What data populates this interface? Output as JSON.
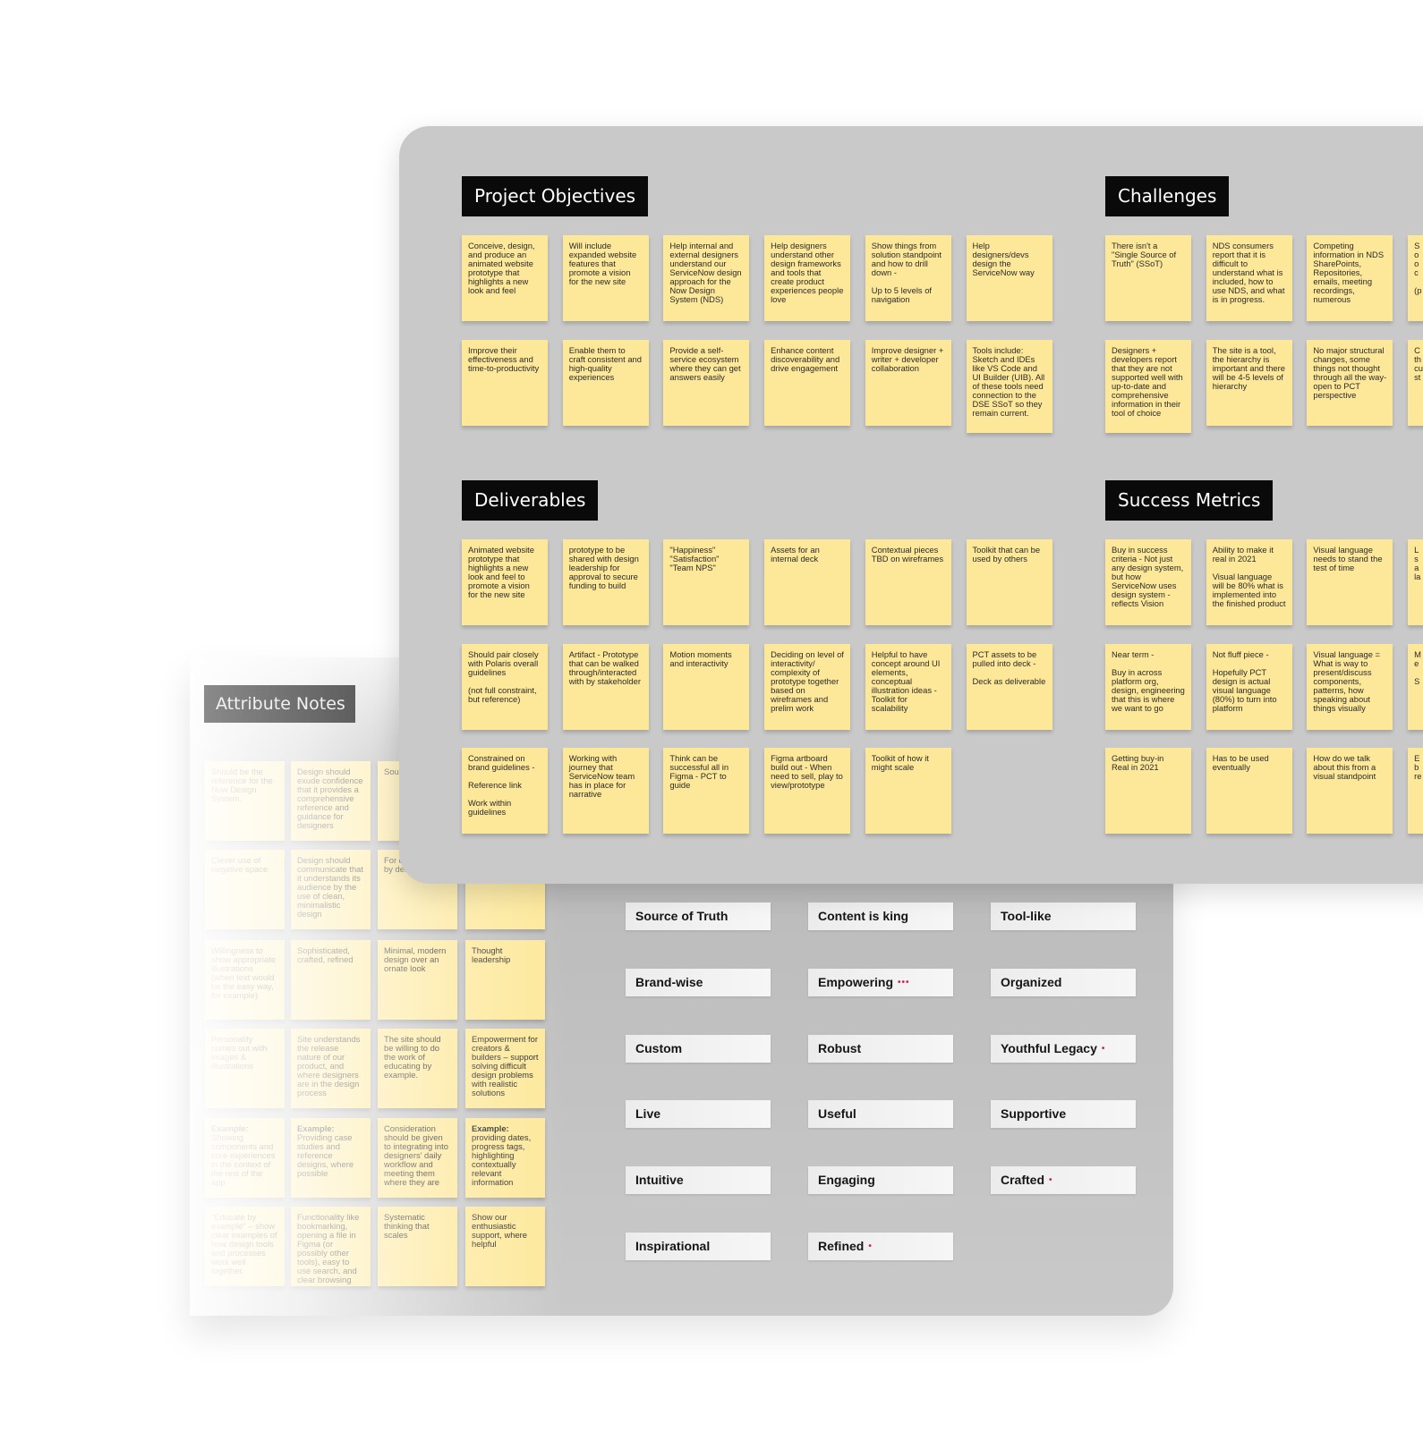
{
  "attribute_notes": {
    "title": "Attribute Notes",
    "columns": [
      [
        "Should be the reference for the Now Design System.",
        "Clever use of negative space",
        "Willingness to show appropriate illustrations (when text would be the easy way, for example)",
        "Personality comes out with images & illustrations",
        "Example: Showing components and core experiences in the context of the rest of the app",
        "\"Educate by example\" – show clear examples of how design tools and processes work well together."
      ],
      [
        "Design should exude confidence that it provides a comprehensive reference and guidance for designers",
        "Design should communicate that it understands its audience by the use of clean, minimalistic design",
        "Sophisticated, crafted, refined",
        "Site understands the release nature of our product, and where designers are in the design process",
        "Example: Providing case studies and reference designs, where possible",
        "Functionality like bookmarking, opening a file in Figma (or possibly other tools), easy to use search, and clear browsing"
      ],
      [
        "Sour",
        "For d\nby des",
        "Minimal, modern design over an ornate look",
        "The site should be willing to do the work of educating by example.",
        "Consideration should be given to integrating into designers' daily workflow and meeting them where they are",
        "Systematic thinking that scales"
      ],
      [
        "",
        "",
        "Thought leadership",
        "Empowerment for creators & builders – support solving difficult design problems with realistic solutions",
        "Example:\nproviding dates, progress tags, highlighting contextually relevant information",
        "Show our enthusiastic support, where helpful"
      ]
    ],
    "labels": [
      [
        "Source of Truth",
        "Brand-wise",
        "Custom",
        "Live",
        "Intuitive",
        "Inspirational"
      ],
      [
        "Content is king",
        "Empowering",
        "Robust",
        "Useful",
        "Engaging",
        "Refined"
      ],
      [
        "Tool-like",
        "Organized",
        "Youthful Legacy",
        "Supportive",
        "Crafted",
        ""
      ]
    ],
    "label_marks": {
      "Empowering": "•••",
      "Youthful Legacy": "•",
      "Crafted": "•",
      "Refined": "•"
    }
  },
  "sections": [
    {
      "title": "Project Objectives",
      "rows": [
        [
          "Conceive, design, and produce an animated website prototype that highlights a new look and feel",
          "Will include expanded website features that promote a vision for the new site",
          "Help internal and external designers understand our ServiceNow design approach for the Now Design System (NDS)",
          "Help designers understand other design frameworks and tools that create product experiences people love",
          "Show things from solution standpoint and how to drill down -\n\nUp to 5 levels of navigation",
          "Help designers/devs design the ServiceNow way"
        ],
        [
          "Improve their effectiveness and time-to-productivity",
          "Enable them to craft consistent and high-quality experiences",
          "Provide a self-service ecosystem where they can get answers easily",
          "Enhance content discoverability and drive engagement",
          "Improve designer + writer + developer collaboration",
          "Tools include: Sketch and IDEs like VS Code and UI Builder (UIB). All of these tools need connection to the DSE SSoT so they remain current."
        ]
      ]
    },
    {
      "title": "Challenges",
      "rows": [
        [
          "There isn't a \"Single Source of Truth\" (SSoT)",
          "NDS consumers report that it is difficult to understand what is included, how to use NDS, and what is in progress.",
          "Competing information in NDS SharePoints, Repositories, emails, meeting recordings, numerous",
          "S\no\no\nc\n\n(p"
        ],
        [
          "Designers + developers report that they are not supported well with up-to-date and comprehensive information in their tool of choice",
          "The site is a tool, the hierarchy is important and there will be 4-5 levels of hierarchy",
          "No major structural changes, some things not thought through all the way- open to PCT perspective",
          "C\nth\ncu\nst"
        ]
      ]
    },
    {
      "title": "Deliverables",
      "rows": [
        [
          "Animated website prototype that highlights a new look and feel to promote a vision for the new site",
          "prototype to be shared with design leadership for approval to secure funding to build",
          "\"Happiness\"\n\"Satisfaction\"\n\"Team NPS\"",
          "Assets for an internal deck",
          "Contextual pieces TBD on wireframes",
          "Toolkit that can be used by others"
        ],
        [
          "Should pair closely with Polaris overall guidelines\n\n(not full constraint, but reference)",
          "Artifact - Prototype that can be walked through/interacted with by stakeholder",
          "Motion moments and interactivity",
          "Deciding on level of interactivity/ complexity of prototype together based on wireframes and prelim work",
          "Helpful to have concept around UI elements, conceptual illustration ideas - Toolkit for scalability",
          "PCT assets to be pulled into deck -\n\nDeck as deliverable"
        ],
        [
          "Constrained on brand guidelines -\n\nReference link\n\nWork within guidelines",
          "Working with journey that ServiceNow team has in place for narrative",
          "Think can be successful all in Figma - PCT to guide",
          "Figma artboard build out - When need to sell, play to view/prototype",
          "Toolkit of how it might scale"
        ]
      ]
    },
    {
      "title": "Success Metrics",
      "rows": [
        [
          "Buy in success criteria - Not just any design system, but how ServiceNow uses design system - reflects Vision",
          "Ability to make it real in 2021\n\nVisual language will be 80% what is implemented into the finished product",
          "Visual language needs to stand the test of time",
          "L\ns\na\nla"
        ],
        [
          "Near term -\n\nBuy in across platform org, design, engineering that this is where we want to go",
          "Not fluff piece -\n\nHopefully PCT design is actual visual language (80%) to turn into platform",
          "Visual language = What is way to present/discuss components, patterns, how speaking about things visually",
          "M\ne\n\nS"
        ],
        [
          "Getting buy-in\nReal in 2021",
          "Has to be used eventually",
          "How do we talk about this from a visual standpoint",
          "E\nb\nre"
        ]
      ]
    }
  ],
  "colors": {
    "sticky": "#fde89a",
    "panel": "#c9c9c9",
    "header": "#0a0a0a",
    "mark": "#c42a5c"
  }
}
